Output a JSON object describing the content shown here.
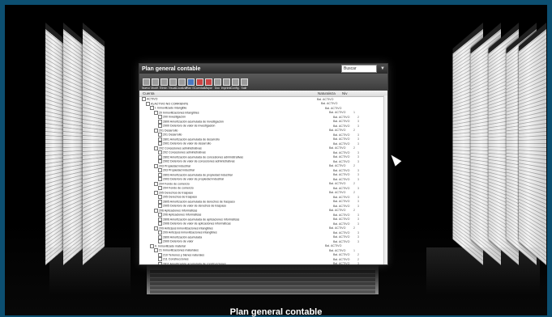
{
  "window": {
    "title": "Plan general contable",
    "combo_value": "Buscar",
    "caption": "Plan general contable"
  },
  "toolbar": [
    {
      "label": "Nuevo",
      "icon": "new-icon"
    },
    {
      "label": "Modif.",
      "icon": "edit-icon"
    },
    {
      "label": "Elimin.",
      "icon": "delete-icon"
    },
    {
      "label": "Visual.",
      "icon": "view-icon"
    },
    {
      "label": "Localizar",
      "icon": "search-icon"
    },
    {
      "label": "Plan G.",
      "icon": "plan-icon"
    },
    {
      "label": "Cuentas",
      "icon": "accounts-icon"
    },
    {
      "label": "Mayor",
      "icon": "ledger-icon"
    },
    {
      "label": "Doc",
      "icon": "document-icon"
    },
    {
      "label": "Imprimir",
      "icon": "print-icon"
    },
    {
      "label": "Config.",
      "icon": "settings-icon"
    },
    {
      "label": "Salir",
      "icon": "exit-icon"
    }
  ],
  "columns": {
    "account": "Cuenta",
    "kind": "Naturaleza",
    "level": "Niv"
  },
  "rows": [
    {
      "name": "ACTIVO",
      "kind": "Bal. ACTIVO",
      "level": "",
      "indent": 0
    },
    {
      "name": "A) ACTIVO NO CORRIENTE",
      "kind": "Bal. ACTIVO",
      "level": "",
      "indent": 1
    },
    {
      "name": "I. Inmovilizado intangible",
      "kind": "Bal. ACTIVO",
      "level": "",
      "indent": 2
    },
    {
      "name": "20 Inmovilizaciones intangibles",
      "kind": "Bal. ACTIVO",
      "level": "1",
      "indent": 3
    },
    {
      "name": "200 Investigación",
      "kind": "Bal. ACTIVO",
      "level": "2",
      "indent": 4
    },
    {
      "name": "2800 Amortización acumulada de investigación",
      "kind": "Bal. ACTIVO",
      "level": "3",
      "indent": 4
    },
    {
      "name": "2900 Deterioro de valor de investigación",
      "kind": "Bal. ACTIVO",
      "level": "3",
      "indent": 4
    },
    {
      "name": "201 Desarrollo",
      "kind": "Bal. ACTIVO",
      "level": "2",
      "indent": 3
    },
    {
      "name": "201 Desarrollo",
      "kind": "Bal. ACTIVO",
      "level": "3",
      "indent": 4
    },
    {
      "name": "2801 Amortización acumulada de desarrollo",
      "kind": "Bal. ACTIVO",
      "level": "3",
      "indent": 4
    },
    {
      "name": "2901 Deterioro de valor de desarrollo",
      "kind": "Bal. ACTIVO",
      "level": "3",
      "indent": 4
    },
    {
      "name": "202 Concesiones administrativas",
      "kind": "Bal. ACTIVO",
      "level": "2",
      "indent": 3
    },
    {
      "name": "202 Concesiones administrativas",
      "kind": "Bal. ACTIVO",
      "level": "3",
      "indent": 4
    },
    {
      "name": "2802 Amortización acumulada de concesiones administrativas",
      "kind": "Bal. ACTIVO",
      "level": "3",
      "indent": 4
    },
    {
      "name": "2902 Deterioro de valor de concesiones administrativas",
      "kind": "Bal. ACTIVO",
      "level": "3",
      "indent": 4
    },
    {
      "name": "203 Propiedad industrial",
      "kind": "Bal. ACTIVO",
      "level": "2",
      "indent": 3
    },
    {
      "name": "203 Propiedad industrial",
      "kind": "Bal. ACTIVO",
      "level": "3",
      "indent": 4
    },
    {
      "name": "2803 Amortización acumulada de propiedad industrial",
      "kind": "Bal. ACTIVO",
      "level": "3",
      "indent": 4
    },
    {
      "name": "2903 Deterioro de valor de propiedad industrial",
      "kind": "Bal. ACTIVO",
      "level": "3",
      "indent": 4
    },
    {
      "name": "204 Fondo de comercio",
      "kind": "Bal. ACTIVO",
      "level": "2",
      "indent": 3
    },
    {
      "name": "204 Fondo de comercio",
      "kind": "Bal. ACTIVO",
      "level": "3",
      "indent": 4
    },
    {
      "name": "205 Derechos de traspaso",
      "kind": "Bal. ACTIVO",
      "level": "2",
      "indent": 3
    },
    {
      "name": "205 Derechos de traspaso",
      "kind": "Bal. ACTIVO",
      "level": "3",
      "indent": 4
    },
    {
      "name": "2805 Amortización acumulada de derechos de traspaso",
      "kind": "Bal. ACTIVO",
      "level": "3",
      "indent": 4
    },
    {
      "name": "2905 Deterioro de valor de derechos de traspaso",
      "kind": "Bal. ACTIVO",
      "level": "3",
      "indent": 4
    },
    {
      "name": "206 Aplicaciones informáticas",
      "kind": "Bal. ACTIVO",
      "level": "2",
      "indent": 3
    },
    {
      "name": "206 Aplicaciones informáticas",
      "kind": "Bal. ACTIVO",
      "level": "3",
      "indent": 4
    },
    {
      "name": "2806 Amortización acumulada de aplicaciones informáticas",
      "kind": "Bal. ACTIVO",
      "level": "3",
      "indent": 4
    },
    {
      "name": "2906 Deterioro de valor de aplicaciones informáticas",
      "kind": "Bal. ACTIVO",
      "level": "3",
      "indent": 4
    },
    {
      "name": "209 Anticipos inmovilizaciones intangibles",
      "kind": "Bal. ACTIVO",
      "level": "2",
      "indent": 3
    },
    {
      "name": "209 Anticipos inmovilizaciones intangibles",
      "kind": "Bal. ACTIVO",
      "level": "3",
      "indent": 4
    },
    {
      "name": "2800 Amortización acumulada",
      "kind": "Bal. ACTIVO",
      "level": "3",
      "indent": 4
    },
    {
      "name": "2900 Deterioro de valor",
      "kind": "Bal. ACTIVO",
      "level": "3",
      "indent": 4
    },
    {
      "name": "II. Inmovilizado material",
      "kind": "Bal. ACTIVO",
      "level": "",
      "indent": 2
    },
    {
      "name": "21 Inmovilizaciones materiales",
      "kind": "Bal. ACTIVO",
      "level": "1",
      "indent": 3
    },
    {
      "name": "210 Terrenos y bienes naturales",
      "kind": "Bal. ACTIVO",
      "level": "2",
      "indent": 4
    },
    {
      "name": "211 Construcciones",
      "kind": "Bal. ACTIVO",
      "level": "2",
      "indent": 4
    },
    {
      "name": "2811 Amortización acumulada de construcciones",
      "kind": "Bal. ACTIVO",
      "level": "3",
      "indent": 4
    }
  ]
}
